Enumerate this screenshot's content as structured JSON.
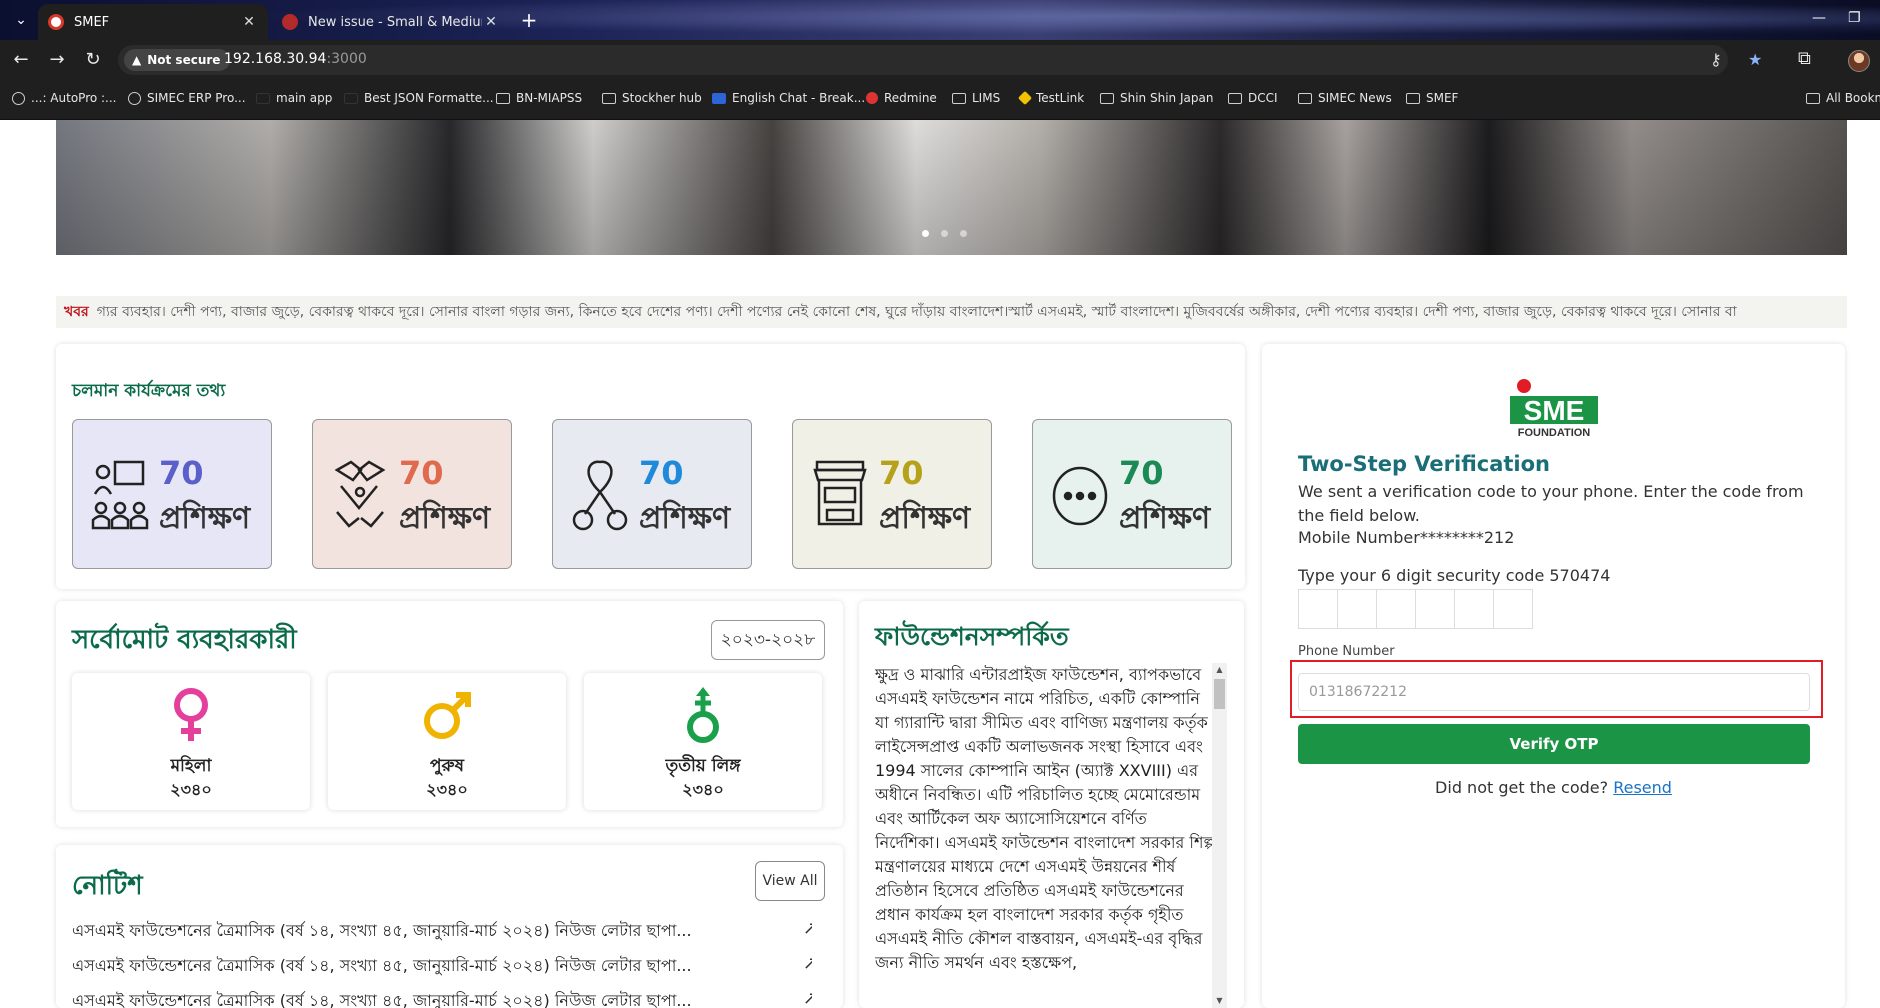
{
  "browser": {
    "tabs": [
      {
        "title": "SMEF",
        "active": true
      },
      {
        "title": "New issue - Small & Medium E",
        "active": false
      }
    ],
    "security_label": "Not secure",
    "url_host": "192.168.30.94",
    "url_port": ":3000",
    "bookmarks": [
      "...: AutoPro :...",
      "SIMEC ERP Pro...",
      "main app",
      "Best JSON Formatte...",
      "BN-MIAPSS",
      "Stockher hub",
      "English Chat - Break...",
      "Redmine",
      "LIMS",
      "TestLink",
      "Shin Shin Japan",
      "DCCI",
      "SIMEC News",
      "SMEF",
      "All Bookm"
    ]
  },
  "ticker": {
    "label": "খবর",
    "text": "গ্যর ব্যবহার। দেশী পণ্য, বাজার জুড়ে, বেকারত্ব থাকবে দূরে। সোনার বাংলা গড়ার জন্য, কিনতে হবে দেশের পণ্য। দেশী পণ্যের নেই কোনো শেষ, ঘুরে দাঁড়ায় বাংলাদেশ।স্মার্ট এসএমই, স্মার্ট বাংলাদেশ। মুজিববর্ষের অঙ্গীকার, দেশী পণ্যের ব্যবহার। দেশী পণ্য, বাজার জুড়ে, বেকারত্ব থাকবে দূরে। সোনার বা"
  },
  "programs": {
    "title": "চলমান কার্যক্রমের তথ্য",
    "items": [
      {
        "count": "70",
        "label": "প্রশিক্ষণ",
        "color": "#5a5fc9",
        "bg": "#e6e6f7",
        "icon": "training-people-icon"
      },
      {
        "count": "70",
        "label": "প্রশিক্ষণ",
        "color": "#e06a4d",
        "bg": "#f3e3df",
        "icon": "handshake-icon"
      },
      {
        "count": "70",
        "label": "প্রশিক্ষণ",
        "color": "#1f8ad9",
        "bg": "#e7eaf1",
        "icon": "ribbon-icon"
      },
      {
        "count": "70",
        "label": "প্রশিক্ষণ",
        "color": "#b5a21a",
        "bg": "#f1f0e6",
        "icon": "shop-icon"
      },
      {
        "count": "70",
        "label": "প্রশিক্ষণ",
        "color": "#1b8a55",
        "bg": "#e7f2ee",
        "icon": "chat-bubble-icon"
      }
    ]
  },
  "users": {
    "title": "সর্বোমোট ব্যবহারকারী",
    "year": "২০২৩-২০২৮",
    "items": [
      {
        "label": "মহিলা",
        "count": "২৩৪০",
        "color": "#e33f9b",
        "icon": "female-icon"
      },
      {
        "label": "পুরুষ",
        "count": "২৩৪০",
        "color": "#f0b400",
        "icon": "male-icon"
      },
      {
        "label": "তৃতীয় লিঙ্গ",
        "count": "২৩৪০",
        "color": "#1aa04a",
        "icon": "third-gender-icon"
      }
    ]
  },
  "notice": {
    "title": "নোটিশ",
    "view_all": "View All",
    "items": [
      "এসএমই ফাউন্ডেশনের ত্রৈমাসিক (বর্ষ ১৪, সংখ্যা ৪৫, জানুয়ারি-মার্চ ২০২৪) নিউজ লেটার ছাপা...",
      "এসএমই ফাউন্ডেশনের ত্রৈমাসিক (বর্ষ ১৪, সংখ্যা ৪৫, জানুয়ারি-মার্চ ২০২৪) নিউজ লেটার ছাপা...",
      "এসএমই ফাউন্ডেশনের ত্রৈমাসিক (বর্ষ ১৪, সংখ্যা ৪৫, জানুয়ারি-মার্চ ২০২৪) নিউজ লেটার ছাপা..."
    ]
  },
  "about": {
    "title": "ফাউন্ডেশনসম্পর্কিত",
    "body": "ক্ষুদ্র ও মাঝারি এন্টারপ্রাইজ ফাউন্ডেশন, ব্যাপকভাবে এসএমই ফাউন্ডেশন নামে পরিচিত, একটি কোম্পানি যা গ্যারান্টি দ্বারা সীমিত এবং বাণিজ্য মন্ত্রণালয় কর্তৃক লাইসেন্সপ্রাপ্ত একটি অলাভজনক সংস্থা হিসাবে এবং 1994 সালের কোম্পানি আইন (অ্যাক্ট XXVIII) এর অধীনে নিবন্ধিত। এটি পরিচালিত হচ্ছে মেমোরেন্ডাম এবং আর্টিকেল অফ অ্যাসোসিয়েশনে বর্ণিত নির্দেশিকা। এসএমই ফাউন্ডেশন বাংলাদেশ সরকার শিল্প মন্ত্রণালয়ের মাধ্যমে দেশে এসএমই উন্নয়নের শীর্ষ প্রতিষ্ঠান হিসেবে প্রতিষ্ঠিত এসএমই ফাউন্ডেশনের প্রধান কার্যক্রম হল বাংলাদেশ সরকার কর্তৃক গৃহীত এসএমই নীতি কৌশল বাস্তবায়ন, এসএমই-এর বৃদ্ধির জন্য নীতি সমর্থন এবং হস্তক্ষেপ,"
  },
  "otp": {
    "logo_text": "SME",
    "logo_sub": "FOUNDATION",
    "title": "Two-Step Verification",
    "description": "We sent a verification code to your phone. Enter the code from the field below.",
    "mobile_line": "Mobile Number********212",
    "code_label": "Type your 6 digit security code 570474",
    "phone_label": "Phone Number",
    "phone_placeholder": "01318672212",
    "verify_button": "Verify OTP",
    "resend_prompt": "Did not get the code?",
    "resend_link": "Resend",
    "accent": "#1c9445",
    "highlight_color": "#e11c24"
  }
}
